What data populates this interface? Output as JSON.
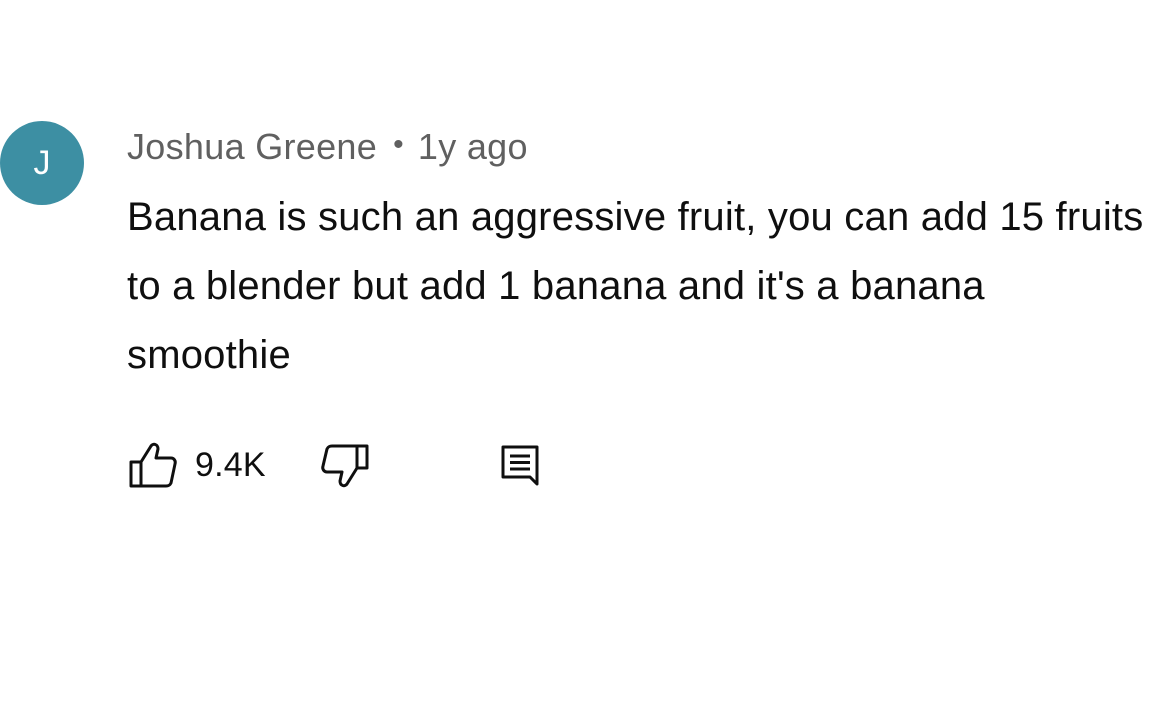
{
  "comment": {
    "avatar_initial": "J",
    "avatar_color": "#3d8fa3",
    "author": "Joshua Greene",
    "separator": "•",
    "time_ago": "1y ago",
    "text": "Banana is such an aggressive fruit, you can add 15 fruits to a blender but add 1 banana and it's a banana smoothie",
    "like_count": "9.4K",
    "icons": {
      "like": "thumbs-up-icon",
      "dislike": "thumbs-down-icon",
      "reply": "reply-comment-icon"
    }
  }
}
